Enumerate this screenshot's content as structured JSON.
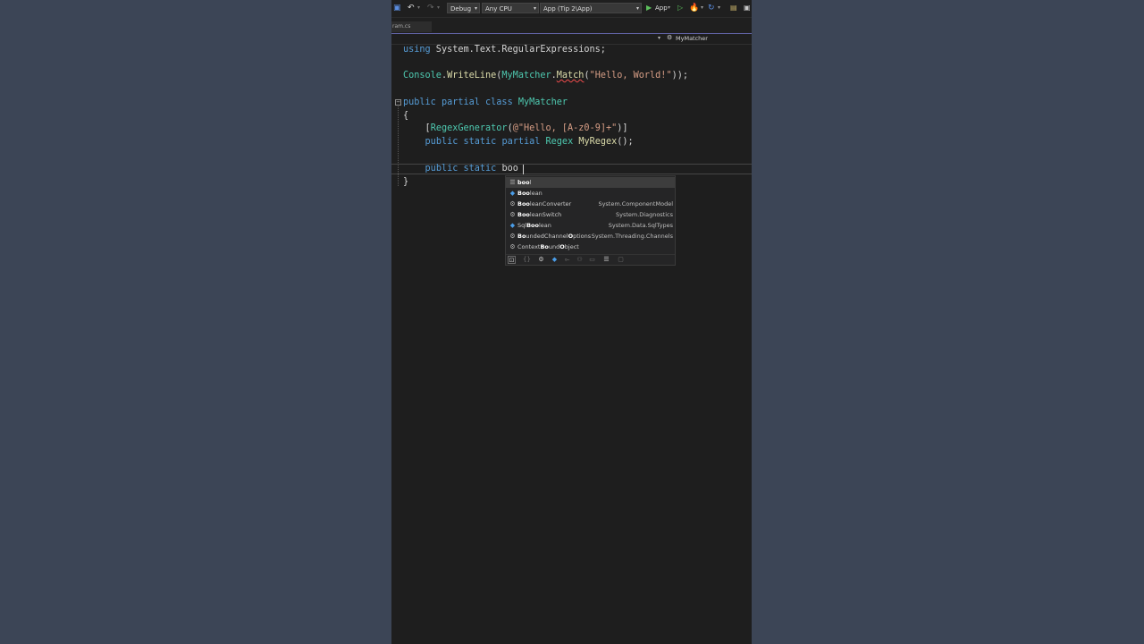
{
  "toolbar": {
    "config": "Debug",
    "platform": "Any CPU",
    "startup_project": "App (Tip 2\\App)",
    "run_label": "App"
  },
  "tab": {
    "label": "ram.cs"
  },
  "navbar": {
    "member": "MyMatcher"
  },
  "code": {
    "l1": {
      "kw": "using",
      "rest": " System.Text.RegularExpressions;"
    },
    "l2": {
      "a": "Console",
      "b": ".",
      "c": "WriteLine",
      "d": "(",
      "e": "MyMatcher",
      "f": ".",
      "g": "Match",
      "h": "(",
      "i": "\"Hello, World!\"",
      "j": "));"
    },
    "l3": {
      "kw1": "public",
      "kw2": "partial",
      "kw3": "class",
      "name": "MyMatcher"
    },
    "l4": {
      "text": "{"
    },
    "l5": {
      "open": "[",
      "attr": "RegexGenerator",
      "p": "(",
      "str": "@\"Hello, [A-z0-9]+\"",
      "close": ")]"
    },
    "l6": {
      "kw1": "public",
      "kw2": "static",
      "kw3": "partial",
      "type": "Regex",
      "fn": "MyRegex",
      "rest": "();"
    },
    "l7": {
      "kw1": "public",
      "kw2": "static",
      "typed": "boo"
    },
    "l8": {
      "text": "}"
    }
  },
  "completion": {
    "items": [
      {
        "bold": "boo",
        "rest": "l",
        "ns": "",
        "icon": "keyword-icon"
      },
      {
        "bold": "Boo",
        "rest": "lean",
        "ns": "",
        "icon": "struct-icon"
      },
      {
        "bold": "Boo",
        "rest": "leanConverter",
        "ns": "System.ComponentModel",
        "icon": "class-icon"
      },
      {
        "bold": "Boo",
        "rest": "leanSwitch",
        "ns": "System.Diagnostics",
        "icon": "class-icon"
      },
      {
        "pre": "Sql",
        "bold": "Boo",
        "rest": "lean",
        "ns": "System.Data.SqlTypes",
        "icon": "struct-icon"
      },
      {
        "bold": "Bo",
        "mid": "undedChannel",
        "bold2": "O",
        "rest": "ptions",
        "ns": "System.Threading.Channels",
        "icon": "class-icon"
      },
      {
        "pre": "Context",
        "bold": "Bo",
        "mid": "und",
        "bold2": "O",
        "rest": "bject",
        "ns": "",
        "icon": "class-icon"
      }
    ]
  }
}
